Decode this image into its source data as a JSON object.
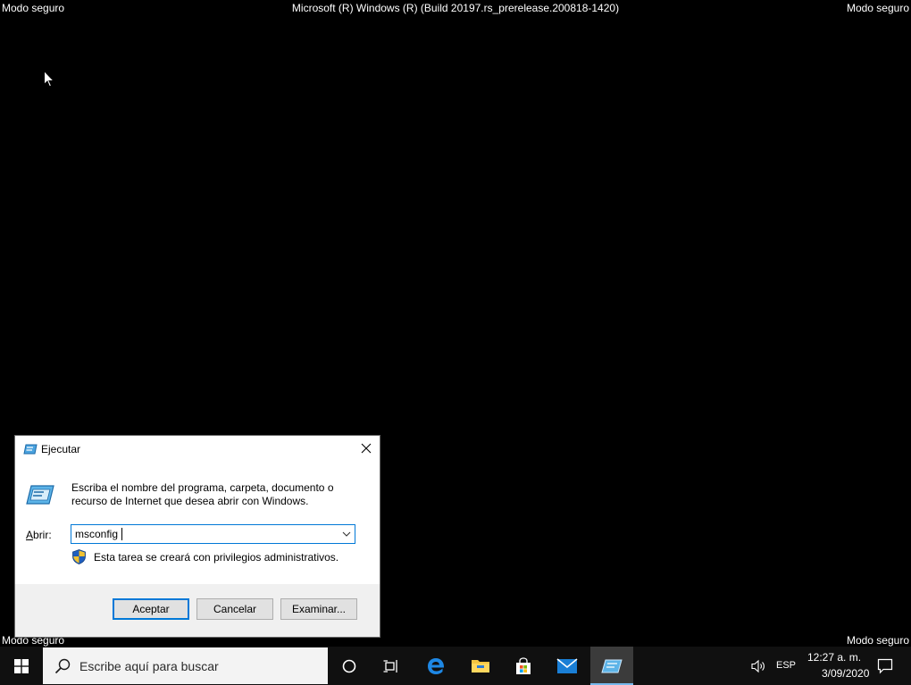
{
  "screen": {
    "safe_mode_label": "Modo seguro",
    "build_info": "Microsoft (R) Windows (R) (Build 20197.rs_prerelease.200818-1420)"
  },
  "run_dialog": {
    "title": "Ejecutar",
    "description": "Escriba el nombre del programa, carpeta, documento o recurso de Internet que desea abrir con Windows.",
    "open_label_accel": "A",
    "open_label_rest": "brir:",
    "open_value": "msconfig",
    "admin_note": "Esta tarea se creará con privilegios administrativos.",
    "ok_label": "Aceptar",
    "cancel_label": "Cancelar",
    "browse_label": "Examinar..."
  },
  "taskbar": {
    "search_placeholder": "Escribe aquí para buscar",
    "language": "ESP",
    "time": "12:27 a. m.",
    "date": "3/09/2020"
  },
  "colors": {
    "desktop": "#000000",
    "accent": "#0078d7",
    "taskbar": "#101010"
  }
}
